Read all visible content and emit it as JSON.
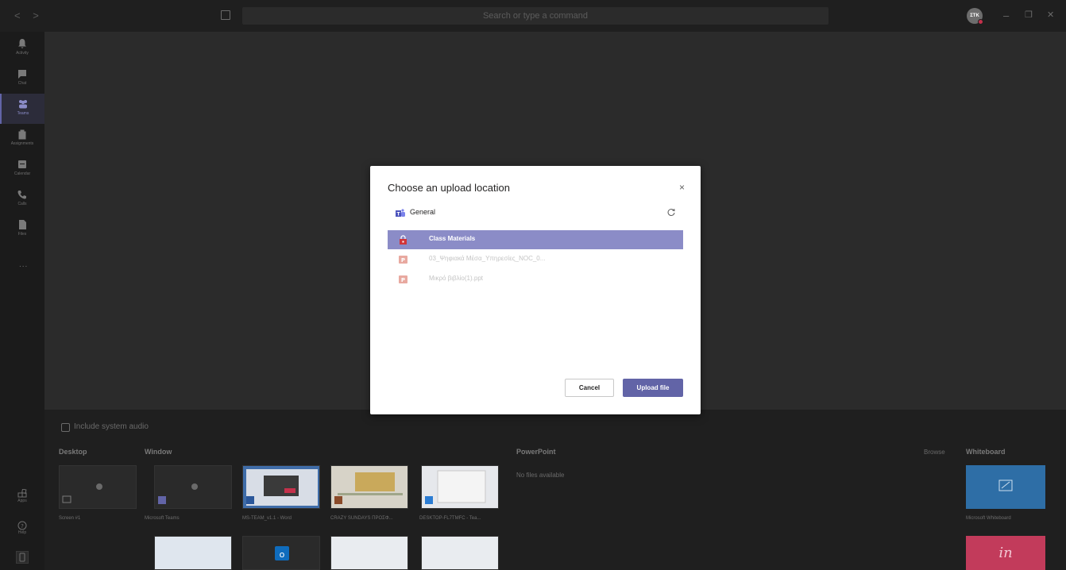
{
  "titlebar": {
    "nav_arrows": "< >",
    "search_placeholder": "Search or type a command",
    "avatar_initials": "ΣΤΚ",
    "minimize": "–",
    "maximize": "❐",
    "close": "✕"
  },
  "rail": {
    "items": [
      {
        "label": "Activity",
        "icon": "bell-icon"
      },
      {
        "label": "Chat",
        "icon": "chat-icon"
      },
      {
        "label": "Teams",
        "icon": "teams-icon",
        "active": true
      },
      {
        "label": "Assignments",
        "icon": "assignments-icon"
      },
      {
        "label": "Calendar",
        "icon": "calendar-icon"
      },
      {
        "label": "Calls",
        "icon": "phone-icon"
      },
      {
        "label": "Files",
        "icon": "file-icon"
      }
    ],
    "more": "...",
    "apps_label": "Apps",
    "help_label": "Help"
  },
  "tray": {
    "include_audio": "Include system audio",
    "desktop_heading": "Desktop",
    "window_heading": "Window",
    "powerpoint_heading": "PowerPoint",
    "no_files": "No files available",
    "browse": "Browse",
    "whiteboard_heading": "Whiteboard",
    "thumbnails": [
      {
        "caption": "Screen #1"
      },
      {
        "caption": "Microsoft Teams"
      },
      {
        "caption": "MS-TEAM_v1.1 - Word"
      },
      {
        "caption": "CRAZY SUNDAYS ΠΡΟΣΦ..."
      },
      {
        "caption": "DESKTOP-FL7TMFC - Tea..."
      }
    ],
    "whiteboard_caption": "Microsoft Whiteboard",
    "invision_label": "in"
  },
  "dialog": {
    "title": "Choose an upload location",
    "close": "×",
    "breadcrumb": "General",
    "items": [
      {
        "label": "Class Materials",
        "type": "locked-folder",
        "selected": true
      },
      {
        "label": "03_Ψηφιακά Μέσα_Υπηρεσίες_ΝΟC_0...",
        "type": "ppt",
        "selected": false
      },
      {
        "label": "Μικρό βιβλίο(1).ppt",
        "type": "ppt",
        "selected": false
      }
    ],
    "cancel_label": "Cancel",
    "upload_label": "Upload file"
  },
  "colors": {
    "accent": "#6264a7",
    "selected_row": "#8b8cc7",
    "ppt": "#e8a9a0",
    "lock_red": "#d13438",
    "whiteboard": "#2e6ea6",
    "invision": "#c23b5b"
  }
}
